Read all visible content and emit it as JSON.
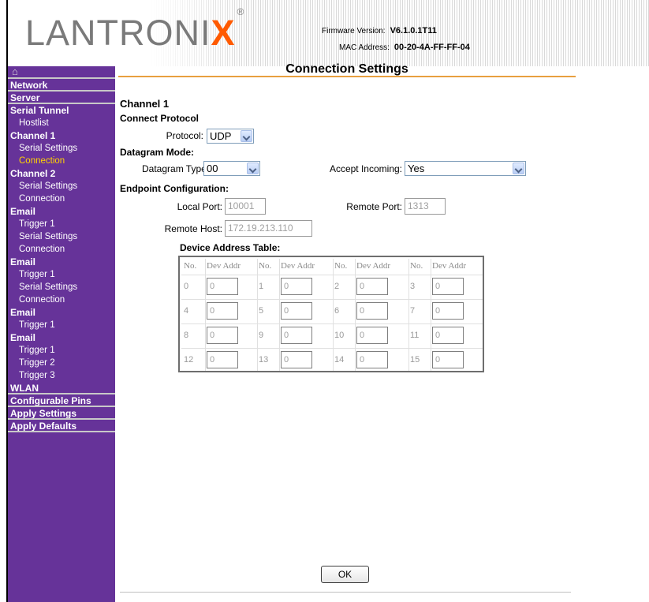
{
  "header": {
    "logo_text": "LANTRONIX",
    "logo_mark": "®",
    "firmware_label": "Firmware Version:",
    "firmware_value": "V6.1.0.1T11",
    "mac_label": "MAC Address:",
    "mac_value": "00-20-4A-FF-FF-04"
  },
  "sidebar": {
    "items": [
      {
        "label": "Network",
        "kind": "head"
      },
      {
        "label": "Server",
        "kind": "head"
      },
      {
        "label": "Serial Tunnel",
        "kind": "head"
      },
      {
        "label": "Hostlist",
        "kind": "sub"
      },
      {
        "label": "Channel 1",
        "kind": "head"
      },
      {
        "label": "Serial Settings",
        "kind": "sub"
      },
      {
        "label": "Connection",
        "kind": "sub-selected"
      },
      {
        "label": "Channel 2",
        "kind": "head"
      },
      {
        "label": "Serial Settings",
        "kind": "sub"
      },
      {
        "label": "Connection",
        "kind": "sub"
      },
      {
        "label": "Email",
        "kind": "head"
      },
      {
        "label": "Trigger 1",
        "kind": "sub"
      },
      {
        "label": "Serial Settings",
        "kind": "sub"
      },
      {
        "label": "Connection",
        "kind": "sub"
      },
      {
        "label": "Email",
        "kind": "head"
      },
      {
        "label": "Trigger 1",
        "kind": "sub"
      },
      {
        "label": "Serial Settings",
        "kind": "sub"
      },
      {
        "label": "Connection",
        "kind": "sub"
      },
      {
        "label": "Email",
        "kind": "head"
      },
      {
        "label": "Trigger 1",
        "kind": "sub"
      },
      {
        "label": "Email",
        "kind": "head"
      },
      {
        "label": "Trigger 1",
        "kind": "sub"
      },
      {
        "label": "Trigger 2",
        "kind": "sub"
      },
      {
        "label": "Trigger 3",
        "kind": "sub"
      },
      {
        "label": "WLAN",
        "kind": "head"
      },
      {
        "label": "Configurable Pins",
        "kind": "head"
      },
      {
        "label": "Apply Settings",
        "kind": "head"
      },
      {
        "label": "Apply Defaults",
        "kind": "head"
      }
    ]
  },
  "main": {
    "title": "Connection Settings",
    "channel": "Channel 1",
    "connect_protocol_heading": "Connect Protocol",
    "protocol_label": "Protocol:",
    "protocol_value": "UDP",
    "datagram_heading": "Datagram Mode:",
    "datagram_type_label": "Datagram Type:",
    "datagram_type_value": "00",
    "accept_incoming_label": "Accept Incoming:",
    "accept_incoming_value": "Yes",
    "endpoint_heading": "Endpoint Configuration:",
    "local_port_label": "Local Port:",
    "local_port_value": "10001",
    "remote_port_label": "Remote Port:",
    "remote_port_value": "1313",
    "remote_host_label": "Remote Host:",
    "remote_host_value": "172.19.213.110",
    "device_table_heading": "Device Address Table:",
    "device_table": {
      "headers": [
        "No.",
        "Dev Addr",
        "No.",
        "Dev Addr",
        "No.",
        "Dev Addr",
        "No.",
        "Dev Addr"
      ],
      "rows": [
        [
          {
            "no": "0",
            "addr": "0"
          },
          {
            "no": "1",
            "addr": "0"
          },
          {
            "no": "2",
            "addr": "0"
          },
          {
            "no": "3",
            "addr": "0"
          }
        ],
        [
          {
            "no": "4",
            "addr": "0"
          },
          {
            "no": "5",
            "addr": "0"
          },
          {
            "no": "6",
            "addr": "0"
          },
          {
            "no": "7",
            "addr": "0"
          }
        ],
        [
          {
            "no": "8",
            "addr": "0"
          },
          {
            "no": "9",
            "addr": "0"
          },
          {
            "no": "10",
            "addr": "0"
          },
          {
            "no": "11",
            "addr": "0"
          }
        ],
        [
          {
            "no": "12",
            "addr": "0"
          },
          {
            "no": "13",
            "addr": "0"
          },
          {
            "no": "14",
            "addr": "0"
          },
          {
            "no": "15",
            "addr": "0"
          }
        ]
      ]
    },
    "ok_label": "OK"
  },
  "colors": {
    "sidebar_bg": "#663399",
    "sidebar_selected": "#ffd200",
    "title_underline": "#e8a040",
    "logo_accent": "#ff5a00"
  }
}
